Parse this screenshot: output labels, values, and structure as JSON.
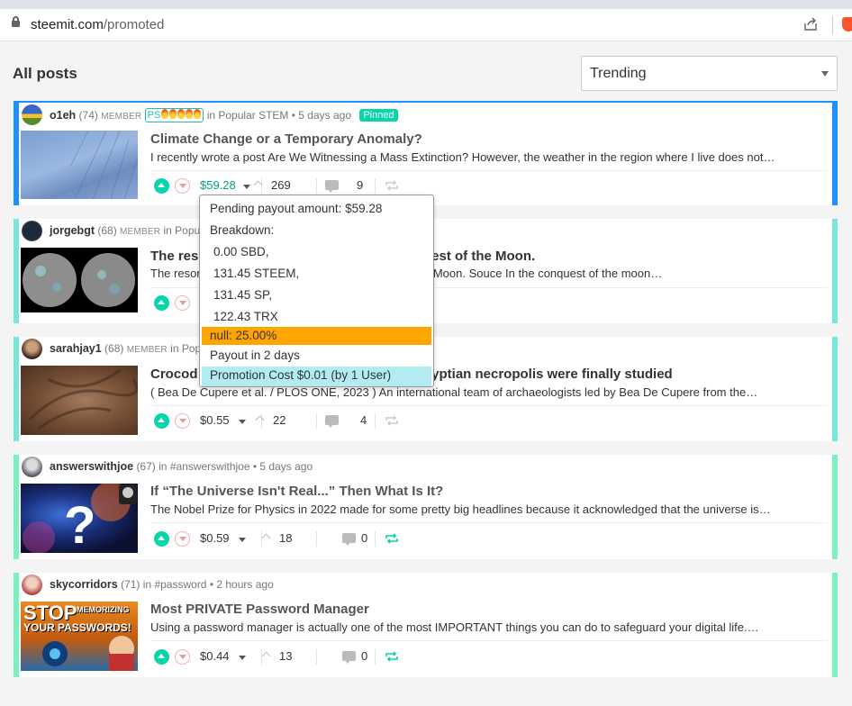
{
  "browser": {
    "url_host": "steemit.com",
    "url_path": "/promoted"
  },
  "header": {
    "title": "All posts",
    "sort_value": "Trending"
  },
  "posts": [
    {
      "author": "o1eh",
      "rep": "(74)",
      "role": "MEMBER",
      "badge": "PS",
      "community_prefix": "in",
      "community": "Popular STEM",
      "time": "• 5 days ago",
      "pinned": "Pinned",
      "title": "Climate Change or a Temporary Anomaly?",
      "excerpt": "I recently wrote a post Are We Witnessing a Mass Extinction? However, the weather in the region where I live does not…",
      "payout": "$59.28",
      "votes": "269",
      "replies": "9"
    },
    {
      "author": "jorgebgt",
      "rep": "(68)",
      "role": "MEMBER",
      "community_prefix": "in",
      "community": "Popu",
      "title_left": "The res",
      "title_right": "uest of the Moon.",
      "excerpt_left": "The resor",
      "excerpt_right": "e Moon. Souce In the conquest of the moon…"
    },
    {
      "author": "sarahjay1",
      "rep": "(68)",
      "role": "MEMBER",
      "community_prefix": "in",
      "community": "Pop",
      "title_left": "Crocod",
      "title_right": "gyptian necropolis were finally studied",
      "excerpt": "( Bea De Cupere et al. / PLOS ONE, 2023 ) An international team of archaeologists led by Bea De Cupere from the…",
      "payout": "$0.55",
      "votes": "22",
      "replies": "4"
    },
    {
      "author": "answerswithjoe",
      "rep": "(67)",
      "community_prefix": "in",
      "community": "#answerswithjoe",
      "time": "• 5 days ago",
      "title": "If “The Universe Isn't Real...” Then What Is It?",
      "excerpt": "The Nobel Prize for Physics in 2022 made for some pretty big headlines because it acknowledged that the universe is…",
      "payout": "$0.59",
      "votes": "18",
      "replies": "0"
    },
    {
      "author": "skycorridors",
      "rep": "(71)",
      "community_prefix": "in",
      "community": "#password",
      "time": "• 2 hours ago",
      "title": "Most PRIVATE Password Manager",
      "excerpt": "Using a password manager is actually one of the most IMPORTANT things you can do to safeguard your digital life.…",
      "payout": "$0.44",
      "votes": "13",
      "replies": "0",
      "thumb_text_1": "STOP",
      "thumb_text_2": "MEMORIZING",
      "thumb_text_3": "YOUR PASSWORDS!"
    }
  ],
  "payout_popup": {
    "pending": "Pending payout amount: $59.28",
    "breakdown": "Breakdown:",
    "sbd": "0.00 SBD,",
    "steem": "131.45 STEEM,",
    "sp": "131.45 SP,",
    "trx": "122.43 TRX",
    "null": "null: 25.00%",
    "payout_in": "Payout in 2 days",
    "promotion": "Promotion Cost $0.01 (by 1 User)"
  },
  "colors": {
    "accent": "#06d6a9",
    "pinned_border": "#1e90ff",
    "promoted_border": "#78e6d8",
    "null_highlight": "#ffa500",
    "promo_highlight": "#b2ebf2"
  }
}
